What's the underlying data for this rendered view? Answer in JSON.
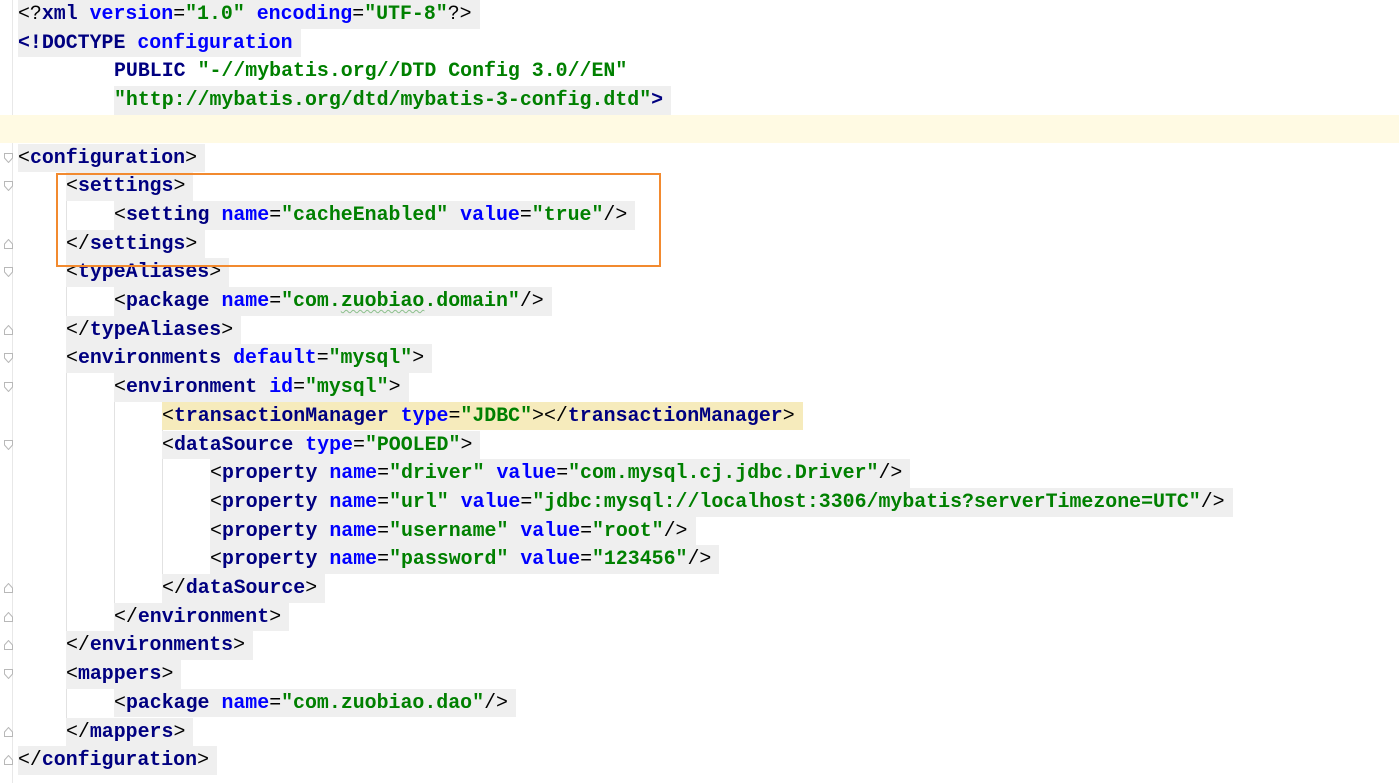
{
  "editor": {
    "language": "XML",
    "highlighted_lines": [
      7,
      8,
      9
    ],
    "highlight_color": "#f28a2f",
    "lines": [
      {
        "n": 1,
        "segments": [
          {
            "cls": "p",
            "text": "<?"
          },
          {
            "cls": "t",
            "text": "xml "
          },
          {
            "cls": "a",
            "text": "version"
          },
          {
            "cls": "p",
            "text": "="
          },
          {
            "cls": "v",
            "text": "\"1.0\""
          },
          {
            "cls": "p",
            "text": " "
          },
          {
            "cls": "a",
            "text": "encoding"
          },
          {
            "cls": "p",
            "text": "="
          },
          {
            "cls": "v",
            "text": "\"UTF-8\""
          },
          {
            "cls": "p",
            "text": "?>"
          }
        ]
      },
      {
        "n": 2,
        "segments": [
          {
            "cls": "t",
            "text": "<!DOCTYPE "
          },
          {
            "cls": "a",
            "text": "configuration"
          }
        ]
      },
      {
        "n": 3,
        "segments": [
          {
            "cls": "t",
            "text": "PUBLIC "
          },
          {
            "cls": "v",
            "text": "\"-//mybatis.org//DTD Config 3.0//EN\""
          }
        ]
      },
      {
        "n": 4,
        "segments": [
          {
            "cls": "v",
            "text": "\"http://mybatis.org/dtd/mybatis-3-config.dtd\""
          },
          {
            "cls": "t",
            "text": ">"
          }
        ]
      },
      {
        "n": 5,
        "segments": []
      },
      {
        "n": 6,
        "segments": [
          {
            "cls": "p",
            "text": "<"
          },
          {
            "cls": "t",
            "text": "configuration"
          },
          {
            "cls": "p",
            "text": ">"
          }
        ]
      },
      {
        "n": 7,
        "segments": [
          {
            "cls": "p",
            "text": "<"
          },
          {
            "cls": "t",
            "text": "settings"
          },
          {
            "cls": "p",
            "text": ">"
          }
        ]
      },
      {
        "n": 8,
        "segments": [
          {
            "cls": "p",
            "text": "<"
          },
          {
            "cls": "t",
            "text": "setting "
          },
          {
            "cls": "a",
            "text": "name"
          },
          {
            "cls": "p",
            "text": "="
          },
          {
            "cls": "v",
            "text": "\"cacheEnabled\""
          },
          {
            "cls": "p",
            "text": " "
          },
          {
            "cls": "a",
            "text": "value"
          },
          {
            "cls": "p",
            "text": "="
          },
          {
            "cls": "v",
            "text": "\"true\""
          },
          {
            "cls": "p",
            "text": "/>"
          }
        ]
      },
      {
        "n": 9,
        "segments": [
          {
            "cls": "p",
            "text": "</"
          },
          {
            "cls": "t",
            "text": "settings"
          },
          {
            "cls": "p",
            "text": ">"
          }
        ]
      },
      {
        "n": 10,
        "segments": [
          {
            "cls": "p",
            "text": "<"
          },
          {
            "cls": "t",
            "text": "typeAliases"
          },
          {
            "cls": "p",
            "text": ">"
          }
        ]
      },
      {
        "n": 11,
        "segments": [
          {
            "cls": "p",
            "text": "<"
          },
          {
            "cls": "t",
            "text": "package "
          },
          {
            "cls": "a",
            "text": "name"
          },
          {
            "cls": "p",
            "text": "="
          },
          {
            "cls": "v",
            "text": "\"com."
          },
          {
            "cls": "v typo",
            "text": "zuobiao"
          },
          {
            "cls": "v",
            "text": ".domain\""
          },
          {
            "cls": "p",
            "text": "/>"
          }
        ]
      },
      {
        "n": 12,
        "segments": [
          {
            "cls": "p",
            "text": "</"
          },
          {
            "cls": "t",
            "text": "typeAliases"
          },
          {
            "cls": "p",
            "text": ">"
          }
        ]
      },
      {
        "n": 13,
        "segments": [
          {
            "cls": "p",
            "text": "<"
          },
          {
            "cls": "t",
            "text": "environments "
          },
          {
            "cls": "a",
            "text": "default"
          },
          {
            "cls": "p",
            "text": "="
          },
          {
            "cls": "v",
            "text": "\"mysql\""
          },
          {
            "cls": "p",
            "text": ">"
          }
        ]
      },
      {
        "n": 14,
        "segments": [
          {
            "cls": "p",
            "text": "<"
          },
          {
            "cls": "t",
            "text": "environment "
          },
          {
            "cls": "a",
            "text": "id"
          },
          {
            "cls": "p",
            "text": "="
          },
          {
            "cls": "v",
            "text": "\"mysql\""
          },
          {
            "cls": "p",
            "text": ">"
          }
        ]
      },
      {
        "n": 15,
        "segments": [
          {
            "cls": "p",
            "text": "<"
          },
          {
            "cls": "t",
            "text": "transactionManager "
          },
          {
            "cls": "a",
            "text": "type"
          },
          {
            "cls": "p",
            "text": "="
          },
          {
            "cls": "v",
            "text": "\"JDBC\""
          },
          {
            "cls": "p",
            "text": "></"
          },
          {
            "cls": "t",
            "text": "transactionManager"
          },
          {
            "cls": "p",
            "text": ">"
          }
        ]
      },
      {
        "n": 16,
        "segments": [
          {
            "cls": "p",
            "text": "<"
          },
          {
            "cls": "t",
            "text": "dataSource "
          },
          {
            "cls": "a",
            "text": "type"
          },
          {
            "cls": "p",
            "text": "="
          },
          {
            "cls": "v",
            "text": "\"POOLED\""
          },
          {
            "cls": "p",
            "text": ">"
          }
        ]
      },
      {
        "n": 17,
        "segments": [
          {
            "cls": "p",
            "text": "<"
          },
          {
            "cls": "t",
            "text": "property "
          },
          {
            "cls": "a",
            "text": "name"
          },
          {
            "cls": "p",
            "text": "="
          },
          {
            "cls": "v",
            "text": "\"driver\""
          },
          {
            "cls": "p",
            "text": " "
          },
          {
            "cls": "a",
            "text": "value"
          },
          {
            "cls": "p",
            "text": "="
          },
          {
            "cls": "v",
            "text": "\"com.mysql.cj.jdbc.Driver\""
          },
          {
            "cls": "p",
            "text": "/>"
          }
        ]
      },
      {
        "n": 18,
        "segments": [
          {
            "cls": "p",
            "text": "<"
          },
          {
            "cls": "t",
            "text": "property "
          },
          {
            "cls": "a",
            "text": "name"
          },
          {
            "cls": "p",
            "text": "="
          },
          {
            "cls": "v",
            "text": "\"url\""
          },
          {
            "cls": "p",
            "text": " "
          },
          {
            "cls": "a",
            "text": "value"
          },
          {
            "cls": "p",
            "text": "="
          },
          {
            "cls": "v",
            "text": "\"jdbc:mysql://localhost:3306/mybatis?serverTimezone=UTC\""
          },
          {
            "cls": "p",
            "text": "/>"
          }
        ]
      },
      {
        "n": 19,
        "segments": [
          {
            "cls": "p",
            "text": "<"
          },
          {
            "cls": "t",
            "text": "property "
          },
          {
            "cls": "a",
            "text": "name"
          },
          {
            "cls": "p",
            "text": "="
          },
          {
            "cls": "v",
            "text": "\"username\""
          },
          {
            "cls": "p",
            "text": " "
          },
          {
            "cls": "a",
            "text": "value"
          },
          {
            "cls": "p",
            "text": "="
          },
          {
            "cls": "v",
            "text": "\"root\""
          },
          {
            "cls": "p",
            "text": "/>"
          }
        ]
      },
      {
        "n": 20,
        "segments": [
          {
            "cls": "p",
            "text": "<"
          },
          {
            "cls": "t",
            "text": "property "
          },
          {
            "cls": "a",
            "text": "name"
          },
          {
            "cls": "p",
            "text": "="
          },
          {
            "cls": "v",
            "text": "\"password\""
          },
          {
            "cls": "p",
            "text": " "
          },
          {
            "cls": "a",
            "text": "value"
          },
          {
            "cls": "p",
            "text": "="
          },
          {
            "cls": "v",
            "text": "\"123456\""
          },
          {
            "cls": "p",
            "text": "/>"
          }
        ]
      },
      {
        "n": 21,
        "segments": [
          {
            "cls": "p",
            "text": "</"
          },
          {
            "cls": "t",
            "text": "dataSource"
          },
          {
            "cls": "p",
            "text": ">"
          }
        ]
      },
      {
        "n": 22,
        "segments": [
          {
            "cls": "p",
            "text": "</"
          },
          {
            "cls": "t",
            "text": "environment"
          },
          {
            "cls": "p",
            "text": ">"
          }
        ]
      },
      {
        "n": 23,
        "segments": [
          {
            "cls": "p",
            "text": "</"
          },
          {
            "cls": "t",
            "text": "environments"
          },
          {
            "cls": "p",
            "text": ">"
          }
        ]
      },
      {
        "n": 24,
        "segments": [
          {
            "cls": "p",
            "text": "<"
          },
          {
            "cls": "t",
            "text": "mappers"
          },
          {
            "cls": "p",
            "text": ">"
          }
        ]
      },
      {
        "n": 25,
        "segments": [
          {
            "cls": "p",
            "text": "<"
          },
          {
            "cls": "t",
            "text": "package "
          },
          {
            "cls": "a",
            "text": "name"
          },
          {
            "cls": "p",
            "text": "="
          },
          {
            "cls": "v",
            "text": "\"com."
          },
          {
            "cls": "v",
            "text": "zuobiao"
          },
          {
            "cls": "v",
            "text": ".dao\""
          },
          {
            "cls": "p",
            "text": "/>"
          }
        ]
      },
      {
        "n": 26,
        "segments": [
          {
            "cls": "p",
            "text": "</"
          },
          {
            "cls": "t",
            "text": "mappers"
          },
          {
            "cls": "p",
            "text": ">"
          }
        ]
      },
      {
        "n": 27,
        "segments": [
          {
            "cls": "p",
            "text": "</"
          },
          {
            "cls": "t",
            "text": "configuration"
          },
          {
            "cls": "p",
            "text": ">"
          }
        ]
      }
    ]
  },
  "colors": {
    "tag": "#000080",
    "attribute": "#0000ff",
    "value": "#008000",
    "punctuation": "#000000",
    "tag_background": "#efefef",
    "match_background": "#f6ebbc",
    "current_line": "#fffae3",
    "highlight_box": "#f28a2f"
  }
}
